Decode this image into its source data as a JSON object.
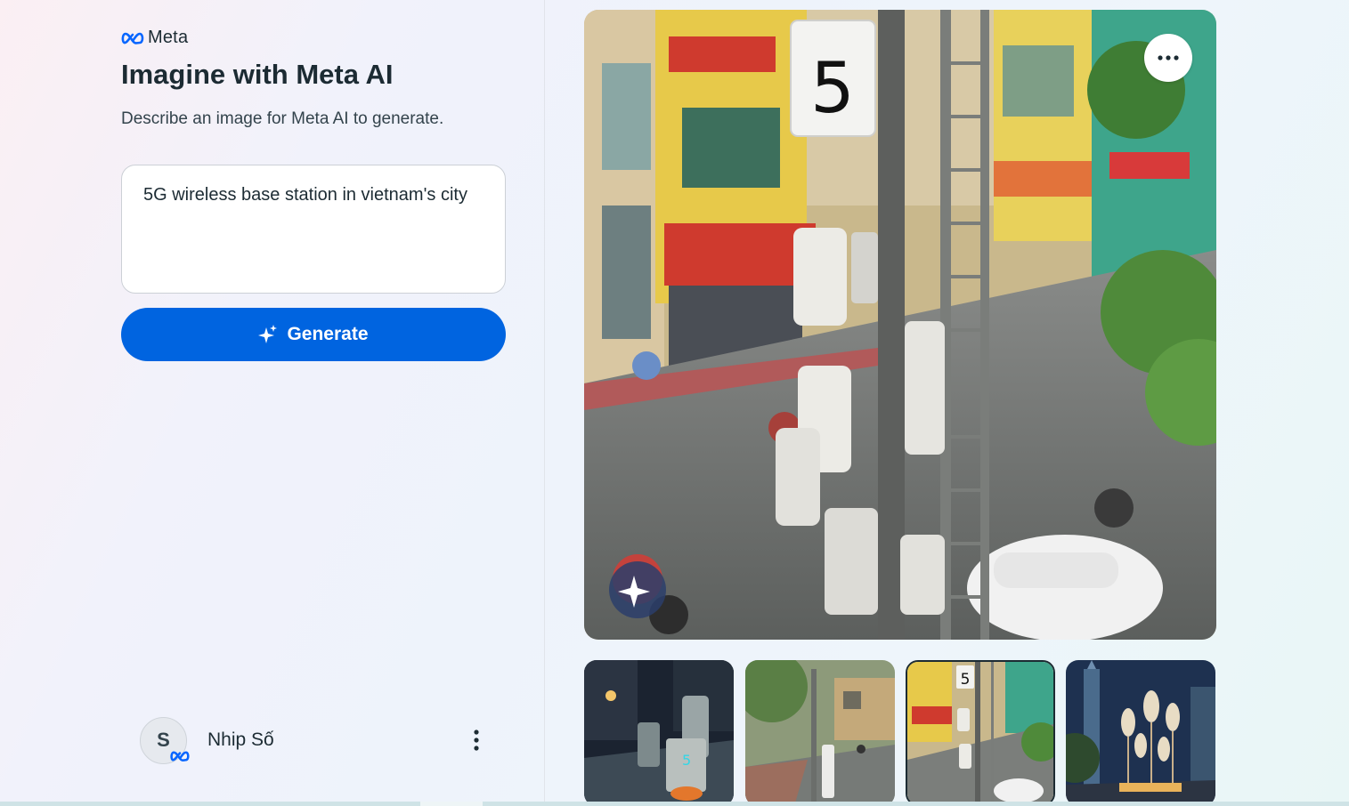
{
  "brand": {
    "logo_text": "Meta"
  },
  "page": {
    "title": "Imagine with Meta AI",
    "subtitle": "Describe an image for Meta AI to generate."
  },
  "prompt": {
    "value": "5G wireless base station in vietnam's city"
  },
  "generate": {
    "label": "Generate"
  },
  "user": {
    "initial": "S",
    "name": "Nhip Số"
  },
  "main_image": {
    "sign_text": "5"
  },
  "thumbnails": [
    {
      "id": "night",
      "sign_text": "5"
    },
    {
      "id": "street"
    },
    {
      "id": "tower",
      "sign_text": "5",
      "selected": true
    },
    {
      "id": "lights"
    }
  ],
  "colors": {
    "accent": "#0064e0",
    "text": "#1c2b33",
    "meta_blue": "#0866ff"
  }
}
